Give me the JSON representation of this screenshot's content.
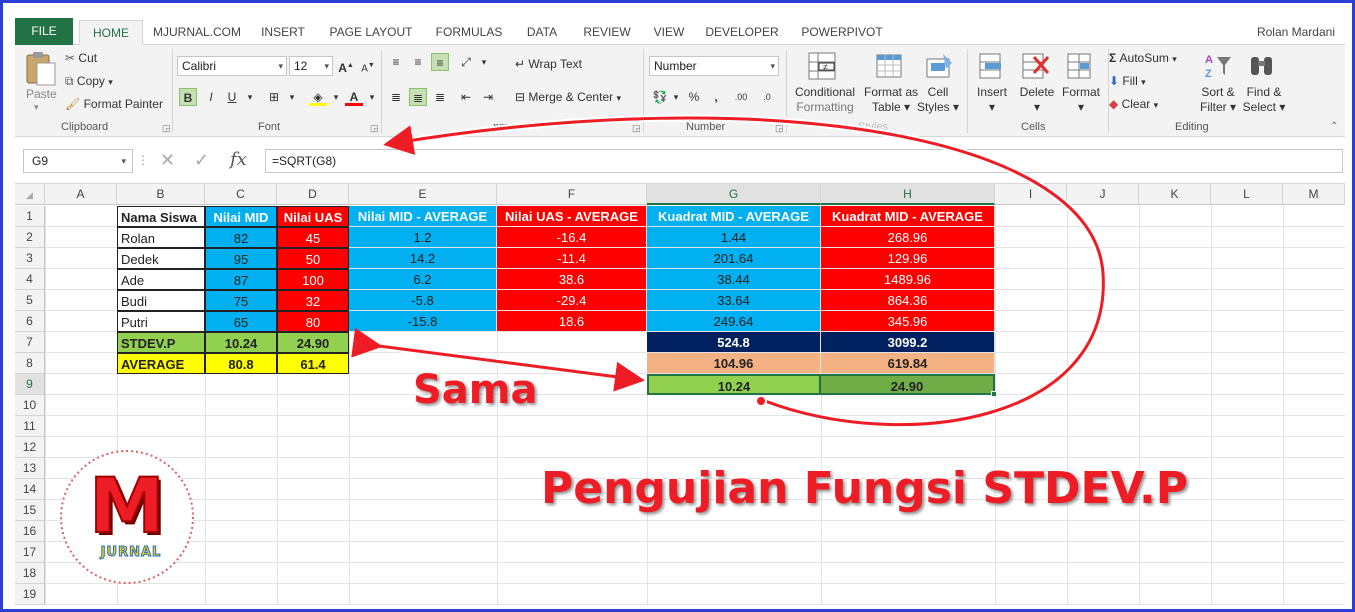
{
  "tabs": [
    "FILE",
    "HOME",
    "MJURNAL.COM",
    "INSERT",
    "PAGE LAYOUT",
    "FORMULAS",
    "DATA",
    "REVIEW",
    "VIEW",
    "DEVELOPER",
    "POWERPIVOT"
  ],
  "user": "Rolan Mardani",
  "ribbon": {
    "clipboard": {
      "paste": "Paste",
      "cut": "Cut",
      "copy": "Copy",
      "format_painter": "Format Painter",
      "label": "Clipboard"
    },
    "font": {
      "name": "Calibri",
      "size": "12",
      "bold": "B",
      "italic": "I",
      "underline": "U",
      "grow": "A",
      "shrink": "A",
      "color_a": "A",
      "label": "Font"
    },
    "alignment": {
      "wrap": "Wrap Text",
      "merge": "Merge & Center",
      "label": "nment"
    },
    "number": {
      "format": "Number",
      "percent": "%",
      "comma": ",",
      "inc": ".00",
      "dec": ".0",
      "label": "Number"
    },
    "styles": {
      "conditional": "Conditional",
      "formatting": "Formatting",
      "format_as": "Format as",
      "table": "Table",
      "cell": "Cell",
      "cell_styles": "Styles",
      "label": "Styles"
    },
    "cells": {
      "insert": "Insert",
      "delete": "Delete",
      "format": "Format",
      "label": "Cells"
    },
    "editing": {
      "autosum": "AutoSum",
      "fill": "Fill",
      "clear": "Clear",
      "sort": "Sort &",
      "filter": "Filter",
      "find": "Find &",
      "select": "Select",
      "label": "Editing"
    }
  },
  "formula_bar": {
    "name_box": "G9",
    "fx": "fx",
    "formula": "=SQRT(G8)"
  },
  "columns": [
    "A",
    "B",
    "C",
    "D",
    "E",
    "F",
    "G",
    "H",
    "I",
    "J",
    "K",
    "L",
    "M"
  ],
  "rows": [
    "1",
    "2",
    "3",
    "4",
    "5",
    "6",
    "7",
    "8",
    "9",
    "10",
    "11",
    "12",
    "13",
    "14",
    "15",
    "16",
    "17",
    "18",
    "19"
  ],
  "sheet": {
    "headers": [
      "Nama Siswa",
      "Nilai MID",
      "Nilai UAS",
      "Nilai MID - AVERAGE",
      "Nilai UAS - AVERAGE",
      "Kuadrat MID - AVERAGE",
      "Kuadrat MID - AVERAGE"
    ],
    "data": [
      [
        "Rolan",
        "82",
        "45",
        "1.2",
        "-16.4",
        "1.44",
        "268.96"
      ],
      [
        "Dedek",
        "95",
        "50",
        "14.2",
        "-11.4",
        "201.64",
        "129.96"
      ],
      [
        "Ade",
        "87",
        "100",
        "6.2",
        "38.6",
        "38.44",
        "1489.96"
      ],
      [
        "Budi",
        "75",
        "32",
        "-5.8",
        "-29.4",
        "33.64",
        "864.36"
      ],
      [
        "Putri",
        "65",
        "80",
        "-15.8",
        "18.6",
        "249.64",
        "345.96"
      ]
    ],
    "stdev_label": "STDEV.P",
    "stdev_mid": "10.24",
    "stdev_uas": "24.90",
    "avg_label": "AVERAGE",
    "avg_mid": "80.8",
    "avg_uas": "61.4",
    "sum_g": "524.8",
    "sum_h": "3099.2",
    "div_g": "104.96",
    "div_h": "619.84",
    "sqrt_g": "10.24",
    "sqrt_h": "24.90"
  },
  "annotations": {
    "sama": "Sama",
    "title": "Pengujian Fungsi STDEV.P"
  },
  "logo": {
    "letter": "M",
    "word": "JURNAL"
  },
  "colors": {
    "excel_green": "#217346",
    "blue": "#00b0f0",
    "red": "#ff0000",
    "annot_red": "#ee1c24",
    "frame": "#2b3fd6"
  }
}
